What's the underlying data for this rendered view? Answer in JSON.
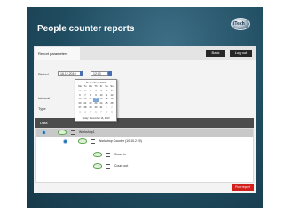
{
  "app": {
    "title": "People counter reports",
    "logo_text": "iTech"
  },
  "tabs": [
    {
      "label": "Report parameters"
    }
  ],
  "toolbar": {
    "back_label": "Back",
    "logout_label": "Log out"
  },
  "form": {
    "period_label": "Period",
    "period_date_value": "16.12.2010",
    "period_time_value": "12:00",
    "interval_label": "Interval",
    "type_label": "Type"
  },
  "calendar": {
    "month_title": "December, 2010",
    "prev": "‹",
    "next": "›",
    "weekdays": [
      "Mo",
      "Tu",
      "We",
      "Th",
      "Fr",
      "Sa",
      "Su"
    ],
    "weeks": [
      [
        "29",
        "30",
        "1",
        "2",
        "3",
        "4",
        "5"
      ],
      [
        "6",
        "7",
        "8",
        "9",
        "10",
        "11",
        "12"
      ],
      [
        "13",
        "14",
        "15",
        "16",
        "17",
        "18",
        "19"
      ],
      [
        "20",
        "21",
        "22",
        "23",
        "24",
        "25",
        "26"
      ],
      [
        "27",
        "28",
        "29",
        "30",
        "31",
        "1",
        "2"
      ],
      [
        "3",
        "4",
        "5",
        "6",
        "7",
        "8",
        "9"
      ]
    ],
    "selected_day": "16",
    "today_label": "Today: December 16, 2010"
  },
  "date_section": {
    "header": "Data"
  },
  "tree": {
    "root_label": "Workshop1",
    "counter_label": "Workshop Counter (10.10.2.20)",
    "count_in_label": "Count in",
    "count_out_label": "Count out"
  },
  "actions": {
    "run_report_label": "Run report"
  },
  "colors": {
    "accent_red": "#d2211d",
    "header_dark": "#262626",
    "bg_teal": "#1f4b5f"
  }
}
